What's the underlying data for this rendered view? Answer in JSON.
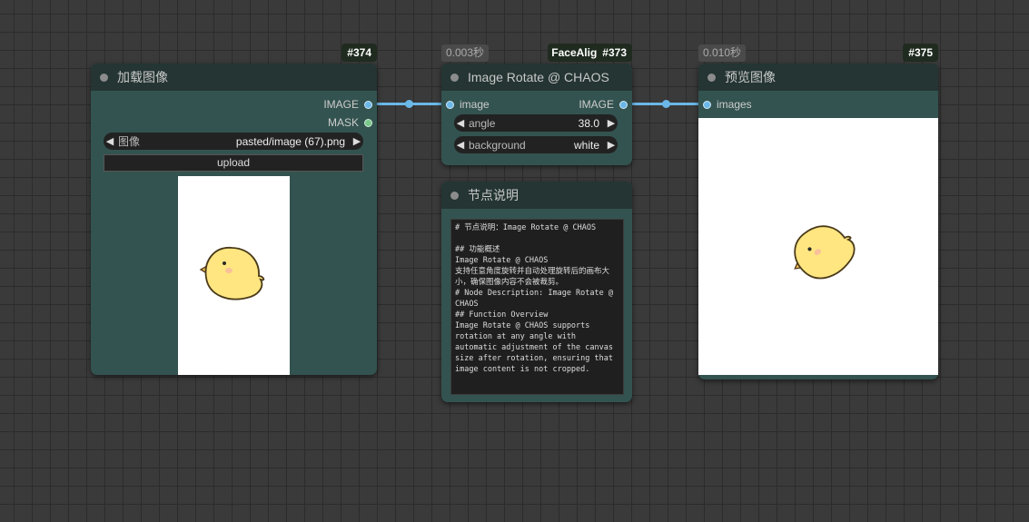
{
  "nodes": {
    "load_image": {
      "id": "#374",
      "title": "加载图像",
      "outputs": [
        "IMAGE",
        "MASK"
      ],
      "image_widget": {
        "label": "图像",
        "value": "pasted/image (67).png"
      },
      "upload_label": "upload"
    },
    "image_rotate": {
      "id": "#373",
      "time": "0.003秒",
      "overlay_label": "FaceAlig",
      "title": "Image Rotate @ CHAOS",
      "input": "image",
      "output": "IMAGE",
      "angle": {
        "label": "angle",
        "value": "38.0"
      },
      "background": {
        "label": "background",
        "value": "white"
      }
    },
    "note": {
      "title": "节点说明",
      "text": "# 节点说明：Image Rotate @ CHAOS\n\n## 功能概述\nImage Rotate @ CHAOS\n支持任意角度旋转并自动处理旋转后的画布大小，确保图像内容不会被裁剪。\n# Node Description: Image Rotate @ CHAOS\n## Function Overview\nImage Rotate @ CHAOS supports rotation at any angle with automatic adjustment of the canvas size after rotation, ensuring that image content is not cropped."
    },
    "preview": {
      "id": "#375",
      "time": "0.010秒",
      "title": "预览图像",
      "input": "images"
    }
  },
  "icons": {
    "node_dot": "circle-dot-icon",
    "arrow_left": "triangle-left-icon",
    "arrow_right": "triangle-right-icon"
  },
  "colors": {
    "canvas": "#3a3a3a",
    "node_body": "#335350",
    "node_header": "#243533",
    "link": "#6bb8e8",
    "mask_port": "#78c88a",
    "chick": "#ffe680"
  }
}
